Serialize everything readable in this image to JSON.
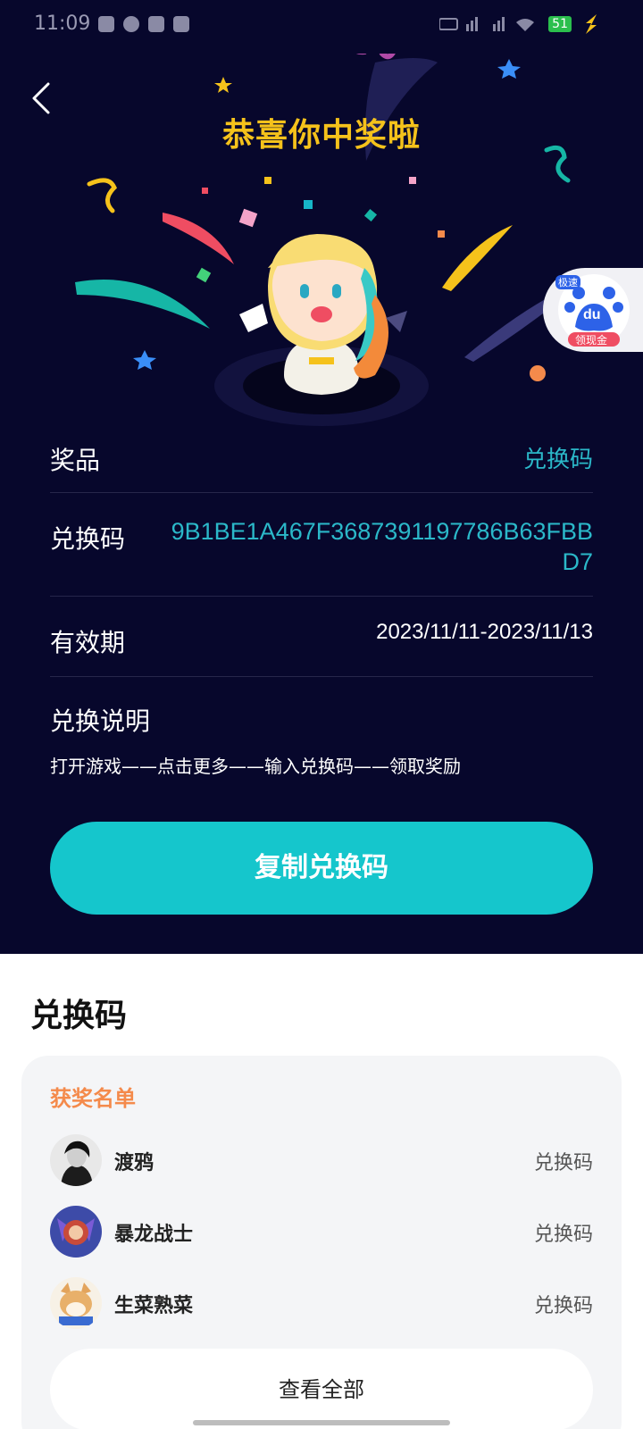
{
  "status_bar": {
    "time": "11:09",
    "battery": "51"
  },
  "header": {
    "title": "恭喜你中奖啦"
  },
  "details": {
    "prize_label": "奖品",
    "prize_value": "兑换码",
    "code_label": "兑换码",
    "code_value": "9B1BE1A467F3687391197786B63FBBD7",
    "validity_label": "有效期",
    "validity_value": "2023/11/11-2023/11/13",
    "instructions_label": "兑换说明",
    "instructions_text": "打开游戏——点击更多——输入兑换码——领取奖励"
  },
  "copy_button": {
    "label": "复制兑换码"
  },
  "floating_widget": {
    "brand": "du",
    "caption": "领现金",
    "tag": "极速"
  },
  "section": {
    "title": "兑换码",
    "winners_title": "获奖名单",
    "winners": [
      {
        "name": "渡鸦",
        "prize": "兑换码"
      },
      {
        "name": "暴龙战士",
        "prize": "兑换码"
      },
      {
        "name": "生菜熟菜",
        "prize": "兑换码"
      }
    ],
    "view_all": "查看全部"
  },
  "colors": {
    "background_dark": "#07072c",
    "accent": "#15c6cc",
    "title_gold": "#f5c21b",
    "winners_orange": "#f48a4b",
    "code_cyan": "#2bb8c9"
  }
}
